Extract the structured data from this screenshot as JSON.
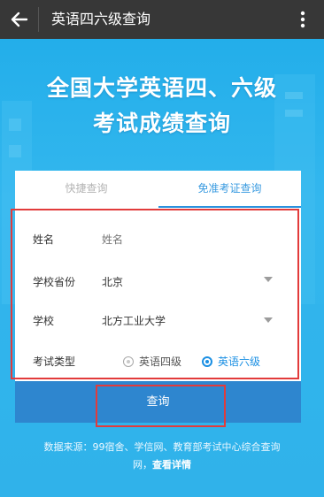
{
  "appbar": {
    "back_icon": "arrow-left-icon",
    "title": "英语四六级查询",
    "more_icon": "more-vertical-icon"
  },
  "hero": {
    "line1": "全国大学英语四、六级",
    "line2": "考试成绩查询"
  },
  "tabs": [
    {
      "label": "快捷查询",
      "active": false
    },
    {
      "label": "免准考证查询",
      "active": true
    }
  ],
  "form": {
    "name": {
      "label": "姓名",
      "placeholder": "姓名"
    },
    "province": {
      "label": "学校省份",
      "value": "北京"
    },
    "school": {
      "label": "学校",
      "value": "北方工业大学"
    },
    "exam_type": {
      "label": "考试类型",
      "options": [
        {
          "label": "英语四级",
          "selected": false
        },
        {
          "label": "英语六级",
          "selected": true
        }
      ]
    }
  },
  "query_button": {
    "label": "查询"
  },
  "footer": {
    "line1": "数据来源：99宿舍、学信网、教育部考试中心综合查询",
    "line2_prefix": "网，",
    "detail_link": "查看详情"
  },
  "colors": {
    "appbar": "#373737",
    "background": "#2ab1ea",
    "accent": "#2b92de",
    "button": "#2e86cf",
    "highlight_box": "#e23b3b"
  }
}
